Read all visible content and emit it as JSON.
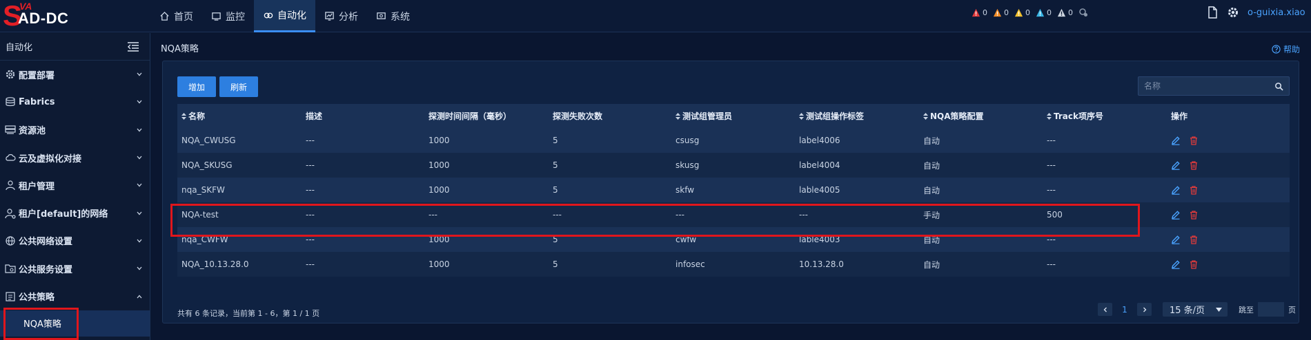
{
  "brand": {
    "logo_letter": "S",
    "logo_sub": "VA",
    "product": "AD-DC"
  },
  "nav": [
    {
      "label": "首页",
      "icon": "home-icon"
    },
    {
      "label": "监控",
      "icon": "monitor-icon"
    },
    {
      "label": "自动化",
      "icon": "automation-icon",
      "active": true
    },
    {
      "label": "分析",
      "icon": "analysis-icon"
    },
    {
      "label": "系统",
      "icon": "system-icon"
    }
  ],
  "alarms": [
    {
      "level": "critical",
      "count": "0",
      "color": "#e23b3b"
    },
    {
      "level": "major",
      "count": "0",
      "color": "#f08a24"
    },
    {
      "level": "minor",
      "count": "0",
      "color": "#f2c12e"
    },
    {
      "level": "warning",
      "count": "0",
      "color": "#39b6e6"
    },
    {
      "level": "info",
      "count": "0",
      "color": "#cfd6e0"
    }
  ],
  "user": {
    "name": "o-guixia.xiao"
  },
  "sidebar": {
    "title": "自动化",
    "items": [
      {
        "label": "配置部署",
        "icon": "gear-icon"
      },
      {
        "label": "Fabrics",
        "icon": "database-icon"
      },
      {
        "label": "资源池",
        "icon": "server-icon"
      },
      {
        "label": "云及虚拟化对接",
        "icon": "cloud-icon"
      },
      {
        "label": "租户管理",
        "icon": "user-icon"
      },
      {
        "label": "租户[default]的网络",
        "icon": "user-network-icon"
      },
      {
        "label": "公共网络设置",
        "icon": "globe-icon"
      },
      {
        "label": "公共服务设置",
        "icon": "service-folder-icon"
      },
      {
        "label": "公共策略",
        "icon": "policy-icon",
        "expanded": true
      }
    ],
    "sub_item": "NQA策略"
  },
  "page": {
    "breadcrumb": "NQA策略",
    "help": "帮助"
  },
  "toolbar": {
    "add_label": "增加",
    "refresh_label": "刷新",
    "search_placeholder": "名称"
  },
  "table": {
    "headers": [
      "名称",
      "描述",
      "探测时间间隔（毫秒）",
      "探测失败次数",
      "测试组管理员",
      "测试组操作标签",
      "NQA策略配置",
      "Track项序号",
      "操作"
    ],
    "sortable": [
      true,
      false,
      false,
      false,
      true,
      true,
      true,
      true,
      false
    ],
    "rows": [
      [
        "NQA_CWUSG",
        "---",
        "1000",
        "5",
        "csusg",
        "label4006",
        "自动",
        "---"
      ],
      [
        "NQA_SKUSG",
        "---",
        "1000",
        "5",
        "skusg",
        "label4004",
        "自动",
        "---"
      ],
      [
        "nqa_SKFW",
        "---",
        "1000",
        "5",
        "skfw",
        "lable4005",
        "自动",
        "---"
      ],
      [
        "NQA-test",
        "---",
        "---",
        "---",
        "---",
        "---",
        "手动",
        "500"
      ],
      [
        "nqa_CWFW",
        "---",
        "1000",
        "5",
        "cwfw",
        "lable4003",
        "自动",
        "---"
      ],
      [
        "NQA_10.13.28.0",
        "---",
        "1000",
        "5",
        "infosec",
        "10.13.28.0",
        "自动",
        "---"
      ]
    ]
  },
  "footer": {
    "summary": "共有 6 条记录，当前第 1 - 6，第 1 / 1 页",
    "current_page": "1",
    "page_size": "15 条/页",
    "jump_label": "跳至",
    "page_unit": "页"
  },
  "colors": {
    "accent": "#2d7fe0",
    "highlight": "#e0161c",
    "link": "#4aa3ff",
    "delete": "#e23b3b"
  }
}
